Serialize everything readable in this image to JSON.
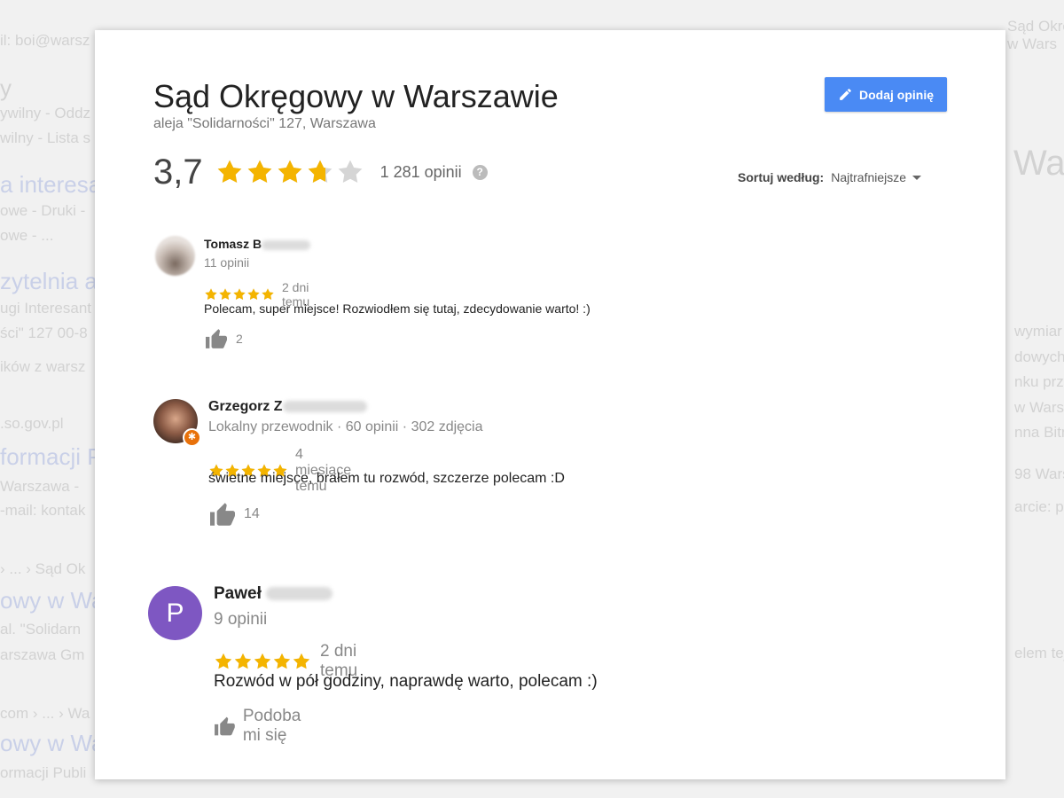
{
  "background": {
    "lines": [
      "il: boi@warsz",
      "y",
      "ywilny - Oddz",
      "wilny - Lista s",
      "a interesa",
      "owe - Druki -",
      "owe - ...",
      "zytelnia a",
      "ugi Interesant",
      "ści\" 127 00-8",
      "ików z warsz",
      ".so.gov.pl",
      "formacji P",
      "Warszawa -",
      "-mail: kontak",
      "› ... › Sąd Ok",
      "owy w Wa",
      "al. \"Solidarn",
      "arszawa Gm",
      "com › ... › Wa",
      "owy w Wa",
      "ormacji Publi",
      "Sąd Okręgow",
      "w Wars",
      "Wa",
      "wymiar",
      "dowych",
      "nku przy",
      "w Warsz",
      "nna Bitn",
      "98 Wars",
      "arcie: pt",
      "elem tej"
    ]
  },
  "place": {
    "title": "Sąd Okręgowy w Warszawie",
    "address": "aleja \"Solidarności\" 127, Warszawa",
    "rating_text": "3,7",
    "rating_value": 3.7,
    "review_count": "1 281 opinii",
    "help_symbol": "?"
  },
  "actions": {
    "add_review_label": "Dodaj opinię",
    "sort_label": "Sortuj według:",
    "sort_value": "Najtrafniejsze"
  },
  "colors": {
    "accent": "#4a8af4",
    "star": "#f4b400",
    "star_empty": "#d5d5d5",
    "avatar_p": "#7e57c2"
  },
  "reviews": [
    {
      "name": "Tomasz B",
      "meta": "11 opinii",
      "stars": 5,
      "date": "2 dni temu",
      "text": "Polecam, super miejsce! Rozwiodłem się tutaj, zdecydowanie warto! :)",
      "likes": "2",
      "icon": "thumbs-up-icon"
    },
    {
      "name": "Grzegorz Z",
      "meta": "Lokalny przewodnik · 60 opinii · 302 zdjęcia",
      "stars": 5,
      "date": "4 miesiące temu",
      "text": "świetne miejsce, brałem tu rozwód, szczerze polecam :D",
      "likes": "14",
      "icon": "thumbs-up-icon"
    },
    {
      "name": "Paweł",
      "initial": "P",
      "meta": "9 opinii",
      "stars": 5,
      "date": "2 dni temu",
      "text": "Rozwód w pół godziny, naprawdę warto, polecam  :)",
      "likes": "Podoba mi się",
      "icon": "thumbs-up-icon"
    }
  ]
}
